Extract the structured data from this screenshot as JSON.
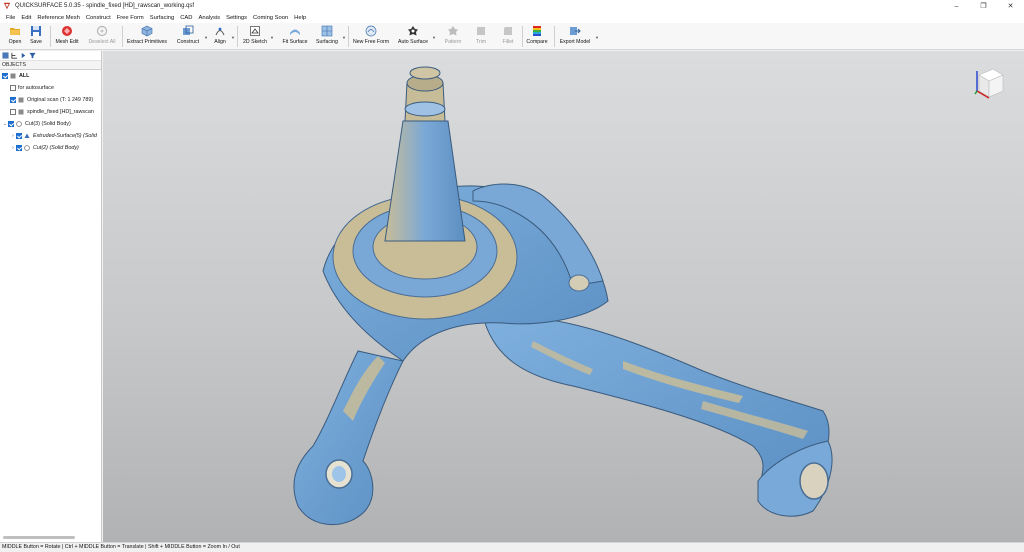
{
  "window": {
    "title": "QUICKSURFACE 5.0.35 - spindle_fixed [HD]_rawscan_working.qsf",
    "controls": [
      "–",
      "❐",
      "✕"
    ]
  },
  "menu": [
    "File",
    "Edit",
    "Reference Mesh",
    "Construct",
    "Free Form",
    "Surfacing",
    "CAD",
    "Analysis",
    "Settings",
    "Coming Soon",
    "Help"
  ],
  "toolbar": {
    "open": "Open",
    "save": "Save",
    "mesh_edit": "Mesh Edit",
    "deselect_all": "Deselect All",
    "extract_primitives": "Extract Primitives",
    "construct": "Construct",
    "align": "Align",
    "sketch_2d": "2D Sketch",
    "fit_surface": "Fit Surface",
    "surfacing": "Surfacing",
    "new_free_form": "New Free Form",
    "auto_surface": "Auto Surface",
    "pattern": "Pattern",
    "trim": "Trim",
    "fillet": "Fillet",
    "compare": "Compare",
    "export_model": "Export Model"
  },
  "objects_panel": {
    "header": "OBJECTS",
    "items": [
      {
        "label": "ALL",
        "checked": true
      },
      {
        "label": "for autosurface",
        "checked": false
      },
      {
        "label": "Original scan (T: 1 249 789)",
        "checked": true
      },
      {
        "label": "spindle_fixed [HD]_rawscan",
        "checked": false
      },
      {
        "label": "Cut(3) (Solid Body)",
        "checked": true
      },
      {
        "label": "Extruded-Surface(5) (Solid",
        "checked": true
      },
      {
        "label": "Cut(2) (Solid Body)",
        "checked": true
      }
    ]
  },
  "colors": {
    "scan_blue": "#6fa3d4",
    "scan_tan": "#cbbf99",
    "accent": "#1f6fd1"
  },
  "status": {
    "hint": "MIDDLE Button = Rotate | Ctrl + MIDDLE Button = Translate | Shift + MIDDLE Button = Zoom In / Out"
  }
}
